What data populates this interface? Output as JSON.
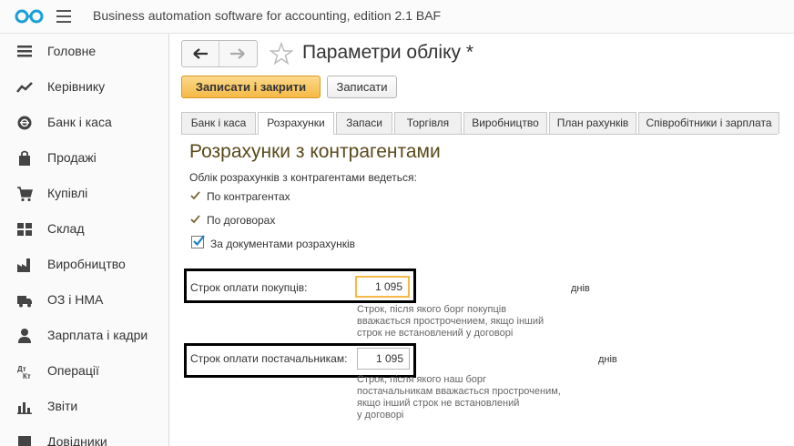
{
  "app": {
    "title": "Business automation software for accounting, edition 2.1 BAF",
    "logo_icon": "baf-logo-icon",
    "menu_icon": "hamburger-menu-icon"
  },
  "sidebar": {
    "items": [
      {
        "label": "Головне",
        "icon": "list-icon"
      },
      {
        "label": "Керівнику",
        "icon": "trend-chart-icon"
      },
      {
        "label": "Банк і каса",
        "icon": "coin-icon"
      },
      {
        "label": "Продажі",
        "icon": "shopping-bag-icon"
      },
      {
        "label": "Купівлі",
        "icon": "cart-icon"
      },
      {
        "label": "Склад",
        "icon": "warehouse-grid-icon"
      },
      {
        "label": "Виробництво",
        "icon": "factory-icon"
      },
      {
        "label": "ОЗ і НМА",
        "icon": "truck-icon"
      },
      {
        "label": "Зарплата і кадри",
        "icon": "person-icon"
      },
      {
        "label": "Операції",
        "icon": "dt-kt-icon"
      },
      {
        "label": "Звіти",
        "icon": "bar-chart-icon"
      },
      {
        "label": "Довідники",
        "icon": "book-icon"
      }
    ]
  },
  "form": {
    "title": "Параметри обліку *",
    "buttons": {
      "save_close": "Записати і закрити",
      "save": "Записати"
    },
    "tabs": [
      {
        "label": "Банк і каса",
        "active": false
      },
      {
        "label": "Розрахунки",
        "active": true
      },
      {
        "label": "Запаси",
        "active": false
      },
      {
        "label": "Торгівля",
        "active": false
      },
      {
        "label": "Виробництво",
        "active": false
      },
      {
        "label": "План рахунків",
        "active": false
      },
      {
        "label": "Співробітники і зарплата",
        "active": false
      }
    ]
  },
  "section": {
    "title": "Розрахунки з контрагентами",
    "intro": "Облік розрахунків з контрагентами ведеться:",
    "options": [
      {
        "label": "По контрагентах",
        "checked": true
      },
      {
        "label": "По договорах",
        "checked": true
      },
      {
        "label": "За документами розрахунків",
        "checked": true
      }
    ],
    "customer_term": {
      "label": "Строк оплати покупців:",
      "value": "1 095",
      "unit": "днів",
      "hint": [
        "Строк, після якого борг покупців",
        "вважається прострочением, якщо інший",
        "строк не встановлений у договорі"
      ]
    },
    "supplier_term": {
      "label": "Строк оплати постачальникам:",
      "value": "1 095",
      "unit": "днів",
      "hint": [
        "Строк, після якого наш борг",
        "постачальникам вважається простроченим,",
        "якщо інший строк не встановлений",
        "у договорі"
      ]
    }
  },
  "colors": {
    "accent": "#f5b945",
    "brand": "#1a9fd8",
    "title": "#5a4a1a"
  }
}
